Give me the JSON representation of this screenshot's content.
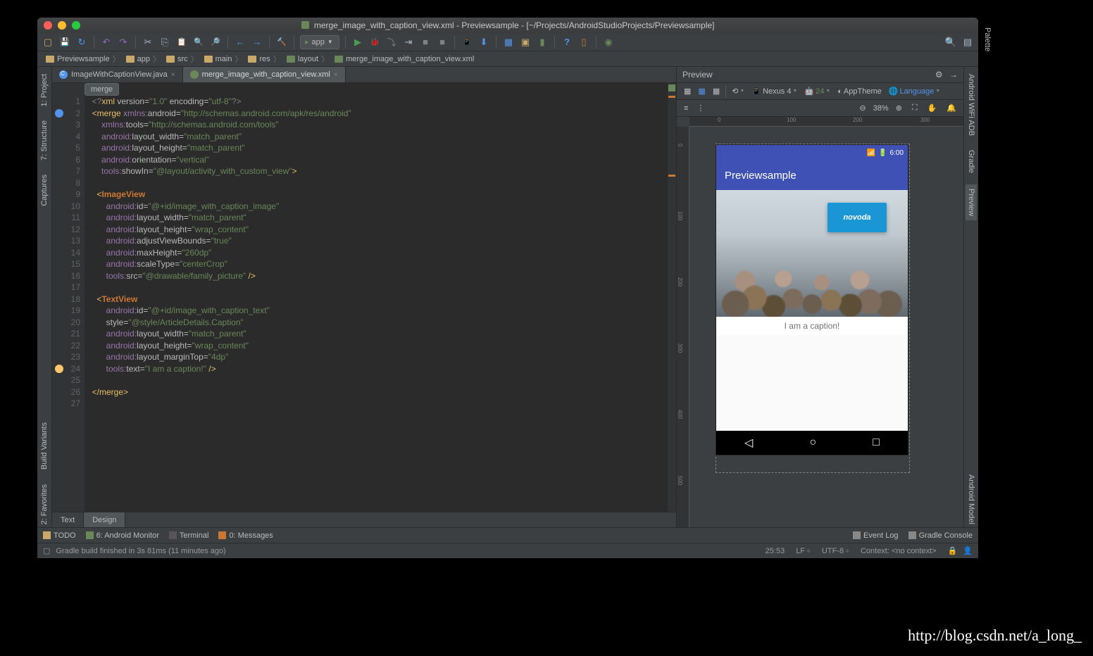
{
  "window": {
    "filename": "merge_image_with_caption_view.xml",
    "project": "Previewsample",
    "path": "[~/Projects/AndroidStudioProjects/Previewsample]"
  },
  "toolbar": {
    "run_config_label": "app"
  },
  "breadcrumbs": [
    {
      "icon": "folder",
      "label": "Previewsample"
    },
    {
      "icon": "folder",
      "label": "app"
    },
    {
      "icon": "folder",
      "label": "src"
    },
    {
      "icon": "folder",
      "label": "main"
    },
    {
      "icon": "folder",
      "label": "res"
    },
    {
      "icon": "layout",
      "label": "layout"
    },
    {
      "icon": "xml",
      "label": "merge_image_with_caption_view.xml"
    }
  ],
  "left_tool_windows": [
    {
      "label": "1: Project"
    },
    {
      "label": "7: Structure"
    },
    {
      "label": "Captures"
    },
    {
      "label": "Build Variants"
    },
    {
      "label": "2: Favorites"
    }
  ],
  "right_tool_windows": [
    {
      "label": "Android WiFi ADB"
    },
    {
      "label": "Gradle"
    },
    {
      "label": "Preview",
      "active": true
    },
    {
      "label": "Android Model"
    }
  ],
  "editor_tabs": [
    {
      "icon": "java",
      "label": "ImageWithCaptionView.java",
      "active": false
    },
    {
      "icon": "xml",
      "label": "merge_image_with_caption_view.xml",
      "active": true
    }
  ],
  "code_breadcrumb": "merge",
  "code_lines": 27,
  "gutter_icons": [
    {
      "line": 2,
      "type": "c"
    },
    {
      "line": 24,
      "type": "bulb"
    }
  ],
  "xml": {
    "l1": "<?xml version=\"1.0\" encoding=\"utf-8\"?>",
    "merge_ns_android": "http://schemas.android.com/apk/res/android",
    "merge_ns_tools": "http://schemas.android.com/tools",
    "layout_width": "match_parent",
    "layout_height": "match_parent",
    "orientation": "vertical",
    "showIn": "@layout/activity_with_custom_view",
    "img_id": "@+id/image_with_caption_image",
    "img_width": "match_parent",
    "img_height": "wrap_content",
    "img_adjust": "true",
    "img_maxH": "260dp",
    "img_scale": "centerCrop",
    "img_src": "@drawable/family_picture",
    "txt_id": "@+id/image_with_caption_text",
    "txt_style": "@style/ArticleDetails.Caption",
    "txt_width": "match_parent",
    "txt_height": "wrap_content",
    "txt_margin": "4dp",
    "txt_text": "I am a caption!"
  },
  "designer_tabs": {
    "text": "Text",
    "design": "Design",
    "active": "Design"
  },
  "preview": {
    "title": "Preview",
    "device": "Nexus 4",
    "api": "24",
    "theme": "AppTheme",
    "lang": "Language",
    "zoom": "38%",
    "status_time": "6:00",
    "app_title": "Previewsample",
    "caption": "I am a caption!",
    "logo": "novoda",
    "ruler_h": [
      "0",
      "100",
      "200",
      "300"
    ],
    "ruler_v": [
      "0",
      "100",
      "200",
      "300",
      "400",
      "500"
    ]
  },
  "bottom_tools": [
    {
      "label": "TODO"
    },
    {
      "label": "6: Android Monitor"
    },
    {
      "label": "Terminal"
    },
    {
      "label": "0: Messages"
    }
  ],
  "bottom_right": [
    {
      "label": "Event Log"
    },
    {
      "label": "Gradle Console"
    }
  ],
  "status": {
    "msg": "Gradle build finished in 3s 81ms (11 minutes ago)",
    "cursor": "25:53",
    "line_sep": "LF",
    "encoding": "UTF-8",
    "context": "Context: <no context>"
  },
  "watermark": "http://blog.csdn.net/a_long_"
}
